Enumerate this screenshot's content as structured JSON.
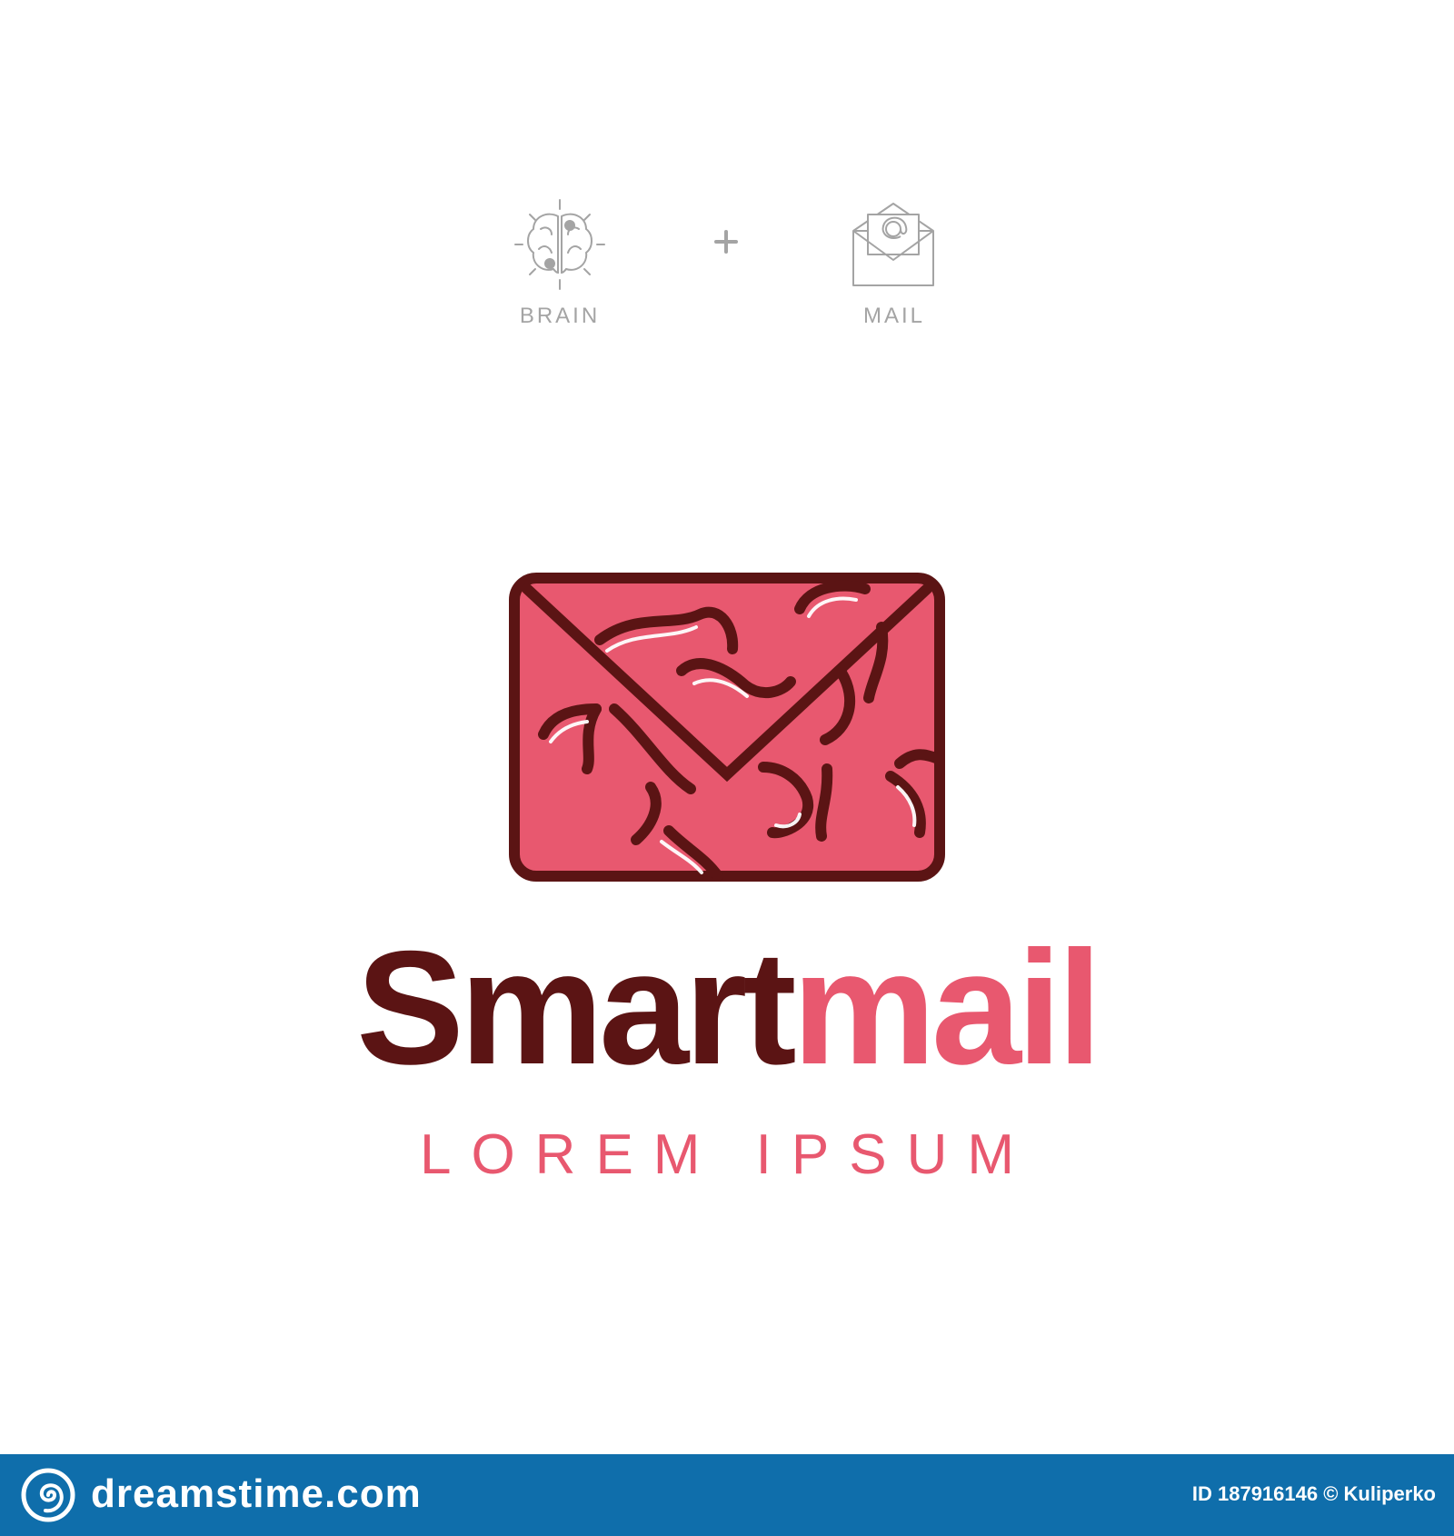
{
  "concept": {
    "left_label": "BRAIN",
    "operator": "+",
    "right_label": "MAIL"
  },
  "logo": {
    "word_primary": "Smart",
    "word_secondary": "mail",
    "tagline": "LOREM IPSUM"
  },
  "colors": {
    "dark_maroon": "#5b1414",
    "brand_pink": "#e8586f",
    "concept_grey": "#a4a4a4",
    "footer_blue": "#0f6eab"
  },
  "footer": {
    "brand": "dreamstime.com",
    "meta": "ID 187916146 © Kuliperko"
  }
}
